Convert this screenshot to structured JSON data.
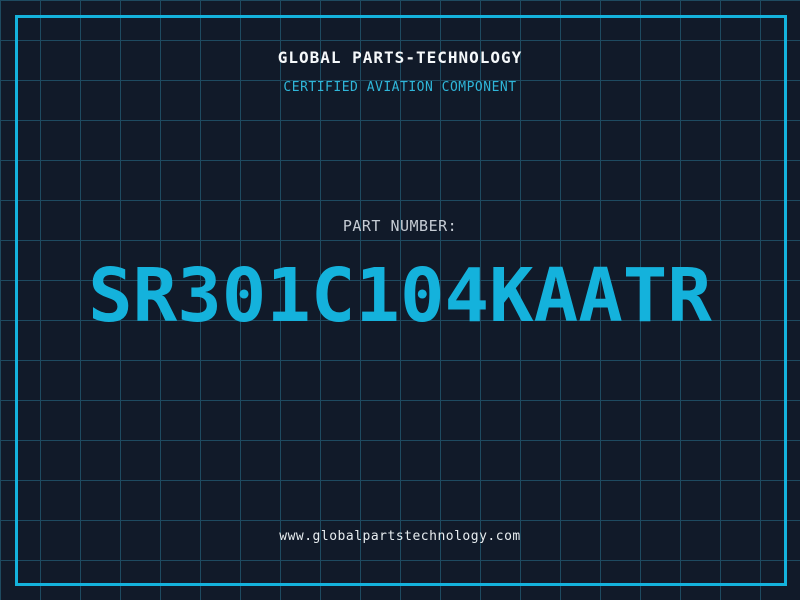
{
  "header": {
    "title": "GLOBAL PARTS-TECHNOLOGY",
    "subtitle": "CERTIFIED AVIATION COMPONENT"
  },
  "part": {
    "label": "PART NUMBER:",
    "number": "SR301C104KAATR"
  },
  "footer": {
    "url": "www.globalpartstechnology.com"
  },
  "colors": {
    "background": "#111a29",
    "grid_line": "#1e4a60",
    "frame_accent": "#14b2dc",
    "title_text": "#f5f8fa",
    "subtitle_text": "#2fb6d9",
    "label_text": "#c6ccd4",
    "part_number_text": "#14b2dc",
    "url_text": "#e8edf0"
  }
}
